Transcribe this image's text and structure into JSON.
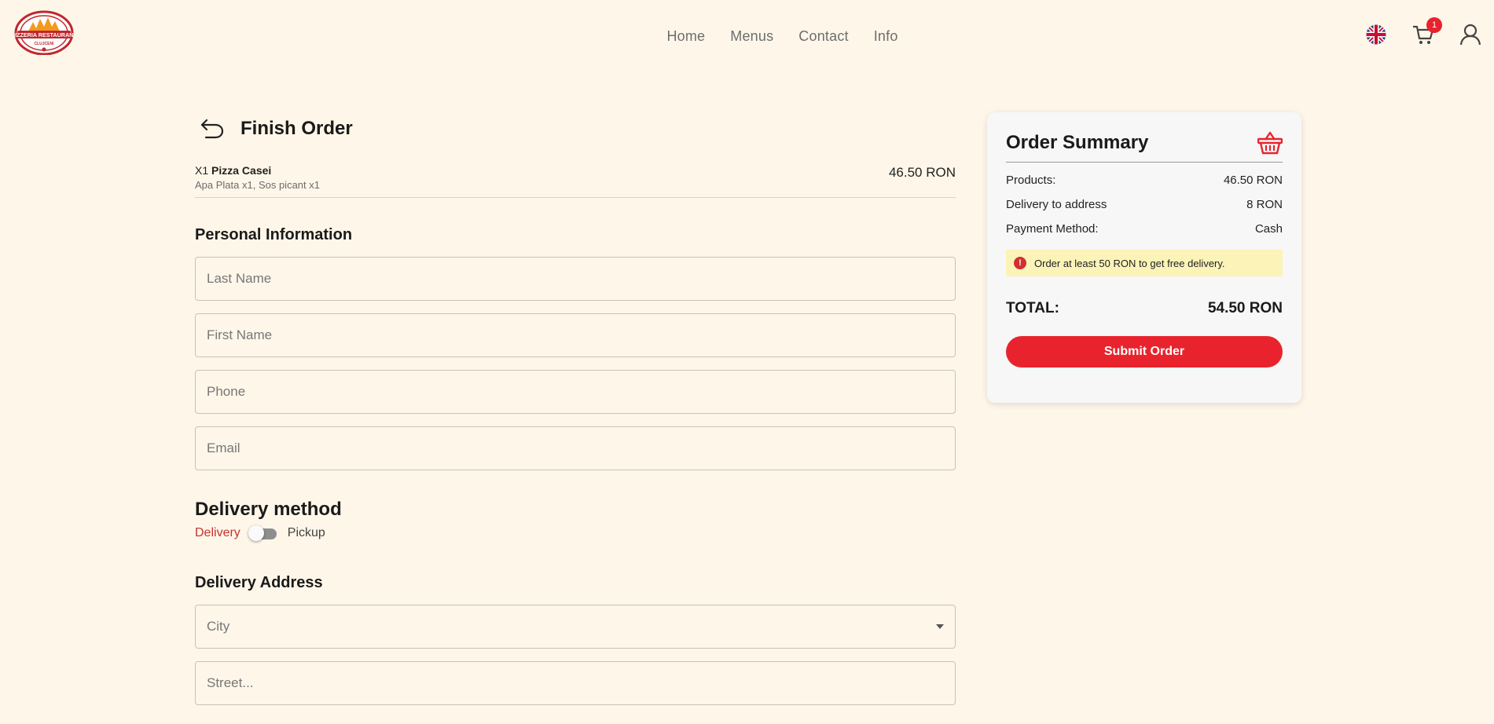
{
  "header": {
    "logo_text": "PIZZERIA RESTAURANT",
    "logo_subtext": "CLUJCENI",
    "nav": [
      {
        "label": "Home"
      },
      {
        "label": "Menus"
      },
      {
        "label": "Contact"
      },
      {
        "label": "Info"
      }
    ],
    "cart_count": "1",
    "icons": {
      "language": "uk-flag-icon",
      "cart": "cart-icon",
      "user": "user-icon"
    }
  },
  "page": {
    "title": "Finish Order",
    "back_icon": "back-arrow-icon"
  },
  "order": {
    "item_qty": "X1",
    "item_name": "Pizza Casei",
    "item_extras": "Apa Plata x1, Sos picant x1",
    "item_price": "46.50 RON"
  },
  "personal": {
    "title": "Personal Information",
    "last_name_placeholder": "Last Name",
    "first_name_placeholder": "First Name",
    "phone_placeholder": "Phone",
    "email_placeholder": "Email"
  },
  "delivery_method": {
    "title": "Delivery method",
    "option_delivery": "Delivery",
    "option_pickup": "Pickup"
  },
  "address": {
    "title": "Delivery Address",
    "city_placeholder": "City",
    "street_placeholder": "Street..."
  },
  "summary": {
    "title": "Order Summary",
    "basket_icon": "basket-icon",
    "products_label": "Products:",
    "products_value": "46.50 RON",
    "delivery_label": "Delivery to address",
    "delivery_value": "8 RON",
    "payment_label": "Payment Method:",
    "payment_value": "Cash",
    "notice_icon_text": "!",
    "notice": "Order at least 50 RON to get free delivery.",
    "total_label": "TOTAL:",
    "total_value": "54.50 RON",
    "submit_label": "Submit Order"
  },
  "colors": {
    "background": "#fef6e9",
    "accent": "#e8232d",
    "notice_bg": "#fbf3b8"
  }
}
